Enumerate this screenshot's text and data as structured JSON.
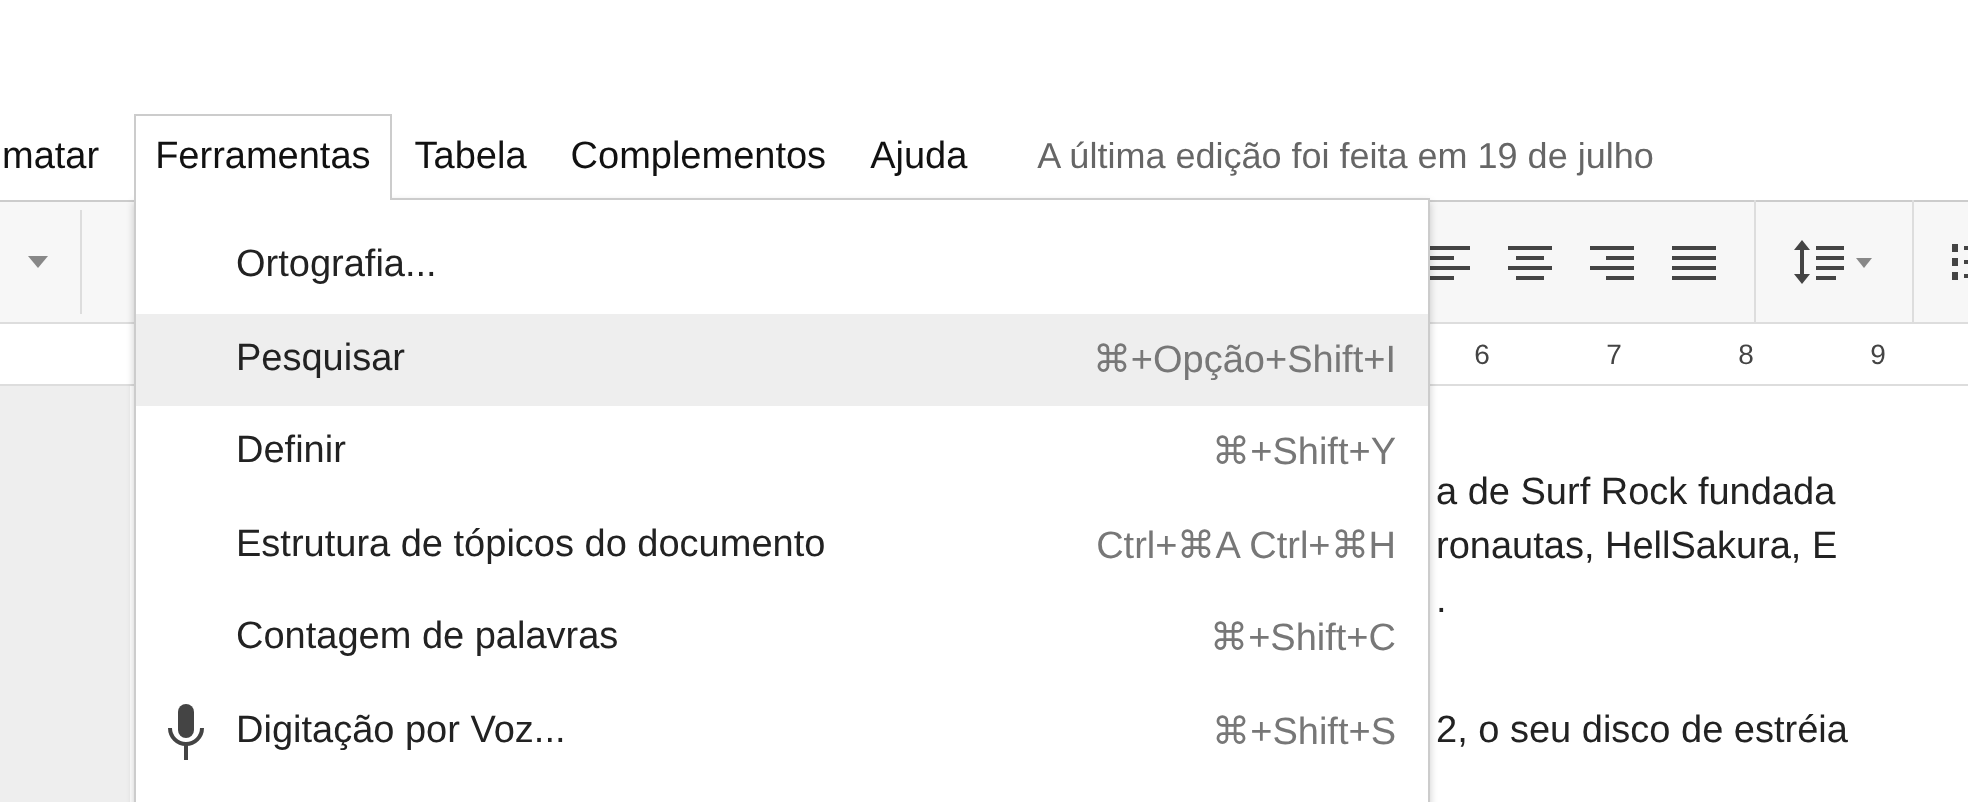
{
  "menu_bar": {
    "items": [
      {
        "label": "matar",
        "selected": false
      },
      {
        "label": "Ferramentas",
        "selected": true
      },
      {
        "label": "Tabela",
        "selected": false
      },
      {
        "label": "Complementos",
        "selected": false
      },
      {
        "label": "Ajuda",
        "selected": false
      }
    ],
    "last_edit": "A última edição foi feita em 19 de julho"
  },
  "ruler": {
    "numbers": [
      "6",
      "7",
      "8",
      "9"
    ]
  },
  "tools_menu": {
    "items": [
      {
        "kind": "plain",
        "label": "Ortografia...",
        "selected": false
      },
      {
        "kind": "plain",
        "label": "Pesquisar",
        "shortcut": "⌘+Opção+Shift+I",
        "selected": true
      },
      {
        "kind": "plain",
        "label": "Definir",
        "shortcut": "⌘+Shift+Y",
        "selected": false
      },
      {
        "kind": "plain",
        "label": "Estrutura de tópicos do documento",
        "shortcut": "Ctrl+⌘A Ctrl+⌘H",
        "selected": false
      },
      {
        "kind": "plain",
        "label": "Contagem de palavras",
        "shortcut": "⌘+Shift+C",
        "selected": false
      },
      {
        "kind": "voice",
        "label": "Digitação por Voz...",
        "shortcut": "⌘+Shift+S",
        "selected": false
      }
    ]
  },
  "document": {
    "lines": [
      "a de Surf Rock fundada",
      "ronautas, HellSakura, E",
      ".",
      "2, o seu disco de estréia"
    ]
  }
}
